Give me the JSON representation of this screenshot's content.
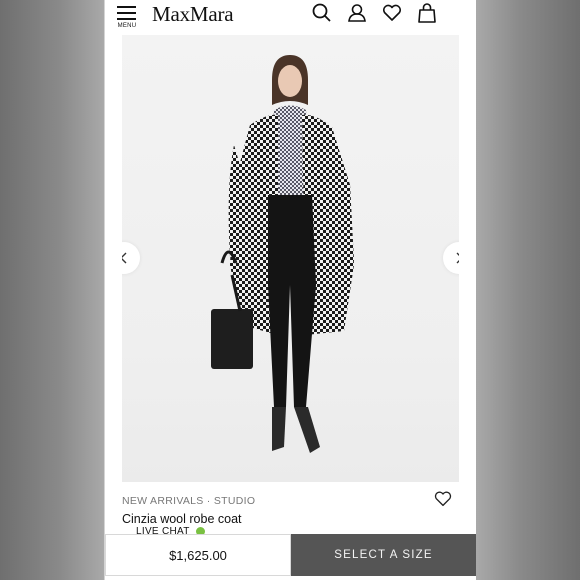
{
  "header": {
    "menu_label": "MENU",
    "logo": "MaxMara",
    "icons": [
      "search-icon",
      "account-icon",
      "wishlist-icon",
      "shopping-bag-icon"
    ]
  },
  "product": {
    "breadcrumb": "NEW ARRIVALS · STUDIO",
    "name": "Cinzia wool robe coat",
    "price": "$1,625.00"
  },
  "chat": {
    "label": "LIVE CHAT",
    "status_color": "#7ac142"
  },
  "cta": {
    "select_size_label": "SELECT A SIZE"
  },
  "colors": {
    "cta_bg": "#555555",
    "text": "#111111",
    "muted": "#777777"
  }
}
